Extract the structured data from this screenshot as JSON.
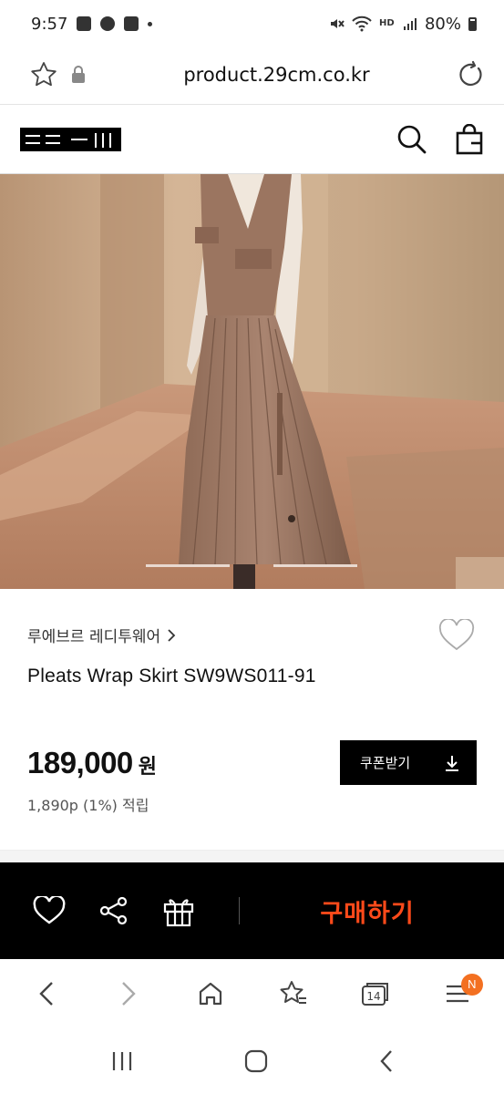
{
  "status_bar": {
    "time": "9:57",
    "battery": "80%"
  },
  "browser": {
    "url": "product.29cm.co.kr",
    "tab_count": "14",
    "menu_badge": "N"
  },
  "product": {
    "brand": "루에브르 레디투웨어",
    "name": "Pleats Wrap Skirt SW9WS011-91",
    "price": "189,000",
    "price_unit": "원",
    "points": "1,890p (1%) 적립",
    "coupon_label": "쿠폰받기"
  },
  "purchase_bar": {
    "buy_label": "구매하기"
  },
  "colors": {
    "buy_accent": "#ff4a1a",
    "badge": "#f37021"
  },
  "icons": {
    "status": [
      "gallery-icon",
      "talk-icon",
      "youtube-icon",
      "mute-icon",
      "wifi-icon",
      "signal-icon",
      "battery-icon"
    ],
    "browser": [
      "star-icon",
      "lock-icon",
      "refresh-icon"
    ],
    "header": [
      "search-icon",
      "shopping-bag-icon"
    ],
    "purchase": [
      "heart-icon",
      "share-icon",
      "gift-icon"
    ],
    "nav": [
      "back-icon",
      "forward-icon",
      "home-icon",
      "bookmark-star-icon",
      "tabs-icon",
      "menu-icon"
    ],
    "system": [
      "recent-apps-icon",
      "home-button-icon",
      "system-back-icon"
    ]
  }
}
